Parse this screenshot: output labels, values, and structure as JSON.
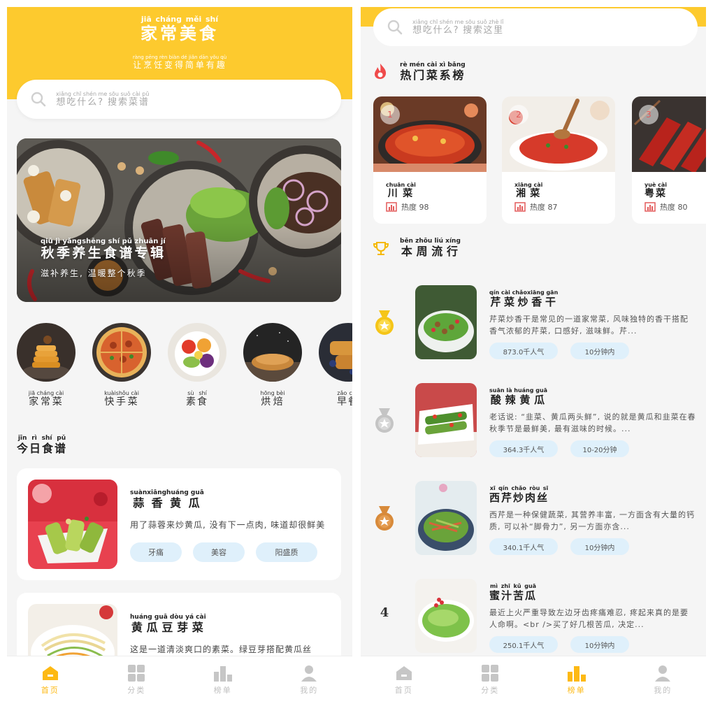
{
  "screen1": {
    "header": {
      "title": "家常美食",
      "title_pinyin": "jiā cháng měi shí",
      "subtitle": "让烹饪变得简单有趣",
      "subtitle_pinyin": "ràng pēng rèn biàn dé jiǎn dān yǒu qù"
    },
    "search": {
      "placeholder": "想吃什么? 搜索菜谱",
      "pinyin": "xiǎng chī shén me sōu suǒ cài pǔ"
    },
    "banner": {
      "title": "秋季养生食谱专辑",
      "title_pinyin": "qiū jì yǎngshēng shí pǔ zhuān jí",
      "subtitle": "滋补养生, 温暖整个秋季"
    },
    "categories": [
      {
        "label": "家常菜",
        "pinyin": "jiā cháng cài"
      },
      {
        "label": "快手菜",
        "pinyin": "kuàishǒu cài"
      },
      {
        "label": "素食",
        "pinyin": "sù shí"
      },
      {
        "label": "烘焙",
        "pinyin": "hōng bèi"
      },
      {
        "label": "早餐",
        "pinyin": "zǎo cān"
      }
    ],
    "today_title": "今日食谱",
    "today_pinyin": "jīn rì shí pǔ",
    "recipes": [
      {
        "name": "蒜香黄瓜",
        "pinyin": "suànxiānghuáng guā",
        "desc": "用了蒜蓉来炒黄瓜, 没有下一点肉, 味道却很鲜美",
        "tags": [
          "牙痛",
          "美容",
          "阳盛质"
        ]
      },
      {
        "name": "黄瓜豆芽菜",
        "pinyin": "huáng guā dòu yá cài",
        "desc": "这是一道清淡爽口的素菜。绿豆芽搭配黄瓜丝",
        "tags": []
      }
    ],
    "nav": [
      {
        "label": "首页"
      },
      {
        "label": "分类"
      },
      {
        "label": "榜单"
      },
      {
        "label": "我的"
      }
    ]
  },
  "screen2": {
    "search": {
      "placeholder": "想吃什么? 搜索这里",
      "pinyin": "xiǎng chī shén me sōu suǒ zhè lǐ"
    },
    "hot_title": "热门菜系榜",
    "hot_pinyin": "rè mén cài xì bǎng",
    "hot_items": [
      {
        "rank": "1",
        "name": "川菜",
        "pinyin": "chuān cài",
        "heat": "热度 98"
      },
      {
        "rank": "2",
        "name": "湘菜",
        "pinyin": "xiāng cài",
        "heat": "热度 87"
      },
      {
        "rank": "3",
        "name": "粤菜",
        "pinyin": "yuè cài",
        "heat": "热度 80"
      }
    ],
    "weekly_title": "本周流行",
    "weekly_pinyin": "běn zhōu liú xíng",
    "trending": [
      {
        "rank": "1",
        "name": "芹菜炒香干",
        "pinyin": "qín cài chǎoxiāng gān",
        "desc": "芹菜炒香干是常见的一道家常菜, 风味独特的香干搭配香气浓郁的芹菜, 口感好, 滋味鲜。芹...",
        "popularity": "873.0千人气",
        "time": "10分钟内"
      },
      {
        "rank": "2",
        "name": "酸辣黄瓜",
        "pinyin": "suān là huáng guā",
        "desc": "老话说: “韭菜、黄瓜两头鲜”, 说的就是黄瓜和韭菜在春秋季节是最鲜美, 最有滋味的时候。...",
        "popularity": "364.3千人气",
        "time": "10-20分钟"
      },
      {
        "rank": "3",
        "name": "西芹炒肉丝",
        "pinyin": "xī qín chǎo ròu sī",
        "desc": "西芹是一种保健蔬菜, 其营养丰富, 一方面含有大量的钙质, 可以补“脚骨力”, 另一方面亦含...",
        "popularity": "340.1千人气",
        "time": "10分钟内"
      },
      {
        "rank": "4",
        "name": "蜜汁苦瓜",
        "pinyin": "mì zhī kǔ guā",
        "desc": "最近上火严重导致左边牙齿疼痛难忍, 疼起来真的是要人命啊。<br />买了好几根苦瓜, 决定...",
        "popularity": "250.1千人气",
        "time": "10分钟内"
      }
    ],
    "nav": [
      {
        "label": "首页"
      },
      {
        "label": "分类"
      },
      {
        "label": "榜单"
      },
      {
        "label": "我的"
      }
    ]
  },
  "colors": {
    "brand_yellow": "#fdca2e",
    "active_nav": "#fdb913",
    "tag_bg": "#dff0fb",
    "hot_red": "#e35a5a"
  }
}
